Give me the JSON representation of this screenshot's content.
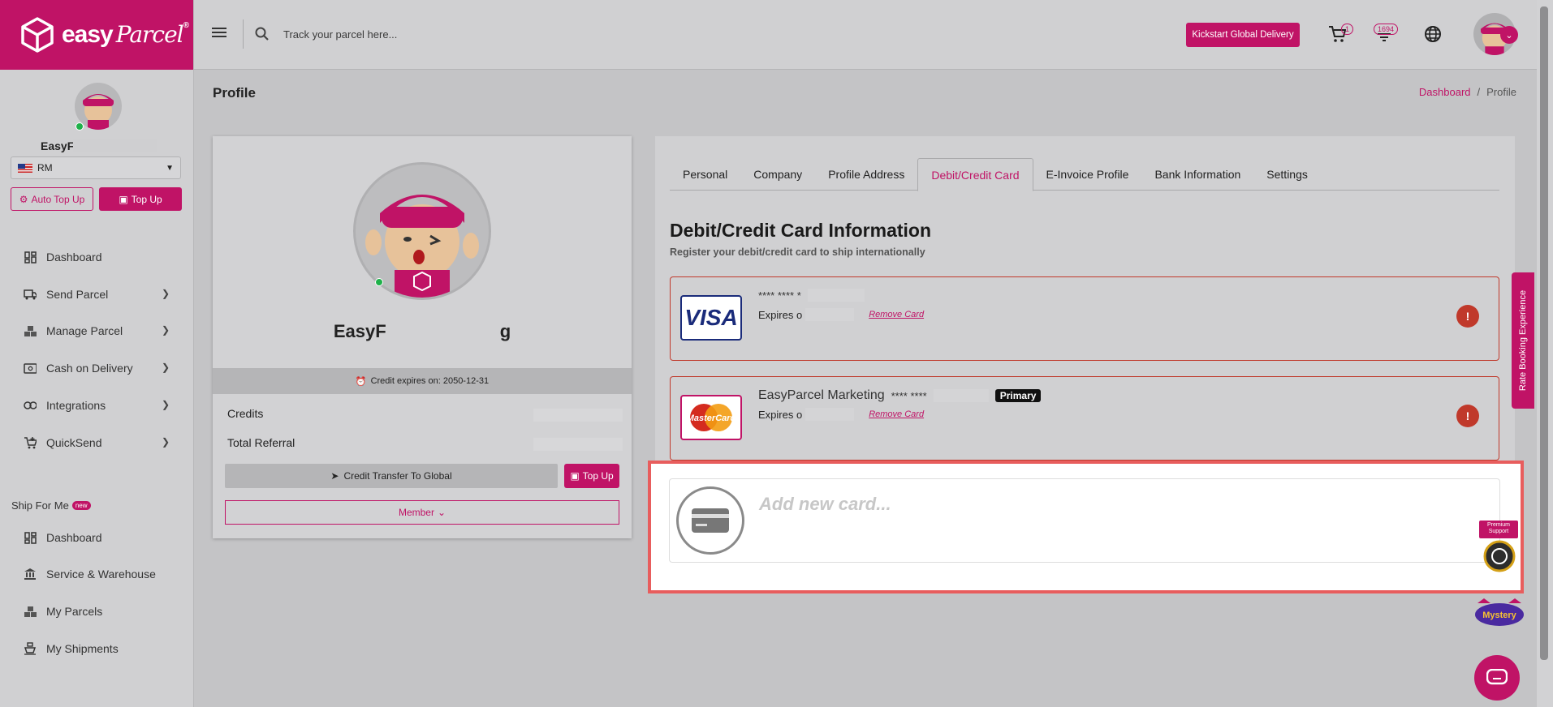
{
  "brand": {
    "name": "easy",
    "script": "Parcel",
    "reg": "®"
  },
  "sidebar": {
    "user_name": "EasyF",
    "wallet_currency": "RM",
    "auto_topup_label": "Auto Top Up",
    "topup_label": "Top Up",
    "nav": [
      {
        "label": "Dashboard",
        "icon": "dashboard-icon"
      },
      {
        "label": "Send Parcel",
        "icon": "truck-icon"
      },
      {
        "label": "Manage Parcel",
        "icon": "boxes-icon"
      },
      {
        "label": "Cash on Delivery",
        "icon": "cash-icon"
      },
      {
        "label": "Integrations",
        "icon": "link-icon"
      },
      {
        "label": "QuickSend",
        "icon": "cart-plus-icon"
      }
    ],
    "ship_for_me_label": "Ship For Me",
    "new_badge": "new",
    "ship_nav": [
      {
        "label": "Dashboard",
        "icon": "dashboard-icon"
      },
      {
        "label": "Service & Warehouse",
        "icon": "bank-icon"
      },
      {
        "label": "My Parcels",
        "icon": "boxes-icon"
      },
      {
        "label": "My Shipments",
        "icon": "ship-icon"
      }
    ]
  },
  "topbar": {
    "search_placeholder": "Track your parcel here...",
    "kickstart_label": "Kickstart Global Delivery",
    "cart_count": "1",
    "notification_count": "1694"
  },
  "page": {
    "title": "Profile",
    "breadcrumb": [
      "Dashboard",
      "/",
      "Profile"
    ]
  },
  "profile": {
    "name_start": "EasyF",
    "name_end": "g",
    "credit_expiry": "Credit expires on: 2050-12-31",
    "credits_label": "Credits",
    "referral_label": "Total Referral",
    "transfer_label": "Credit Transfer To Global",
    "topup_label": "Top Up",
    "member_label": "Member"
  },
  "tabs": [
    "Personal",
    "Company",
    "Profile Address",
    "Debit/Credit Card",
    "E-Invoice Profile",
    "Bank Information",
    "Settings"
  ],
  "active_tab": "Debit/Credit Card",
  "cards_section": {
    "title": "Debit/Credit Card Information",
    "subtitle": "Register your debit/credit card to ship internationally",
    "cards": [
      {
        "brand": "VISA",
        "holder": "",
        "number": "**** **** *",
        "expires": "Expires o",
        "remove": "Remove Card",
        "primary": ""
      },
      {
        "brand": "MasterCard",
        "holder": "EasyParcel Marketing",
        "number": "**** ****",
        "expires": "Expires o",
        "remove": "Remove Card",
        "primary": "Primary"
      }
    ],
    "add_card_label": "Add new card..."
  },
  "floating": {
    "rate_booking": "Rate Booking Experience",
    "premium_support": "Premium Support",
    "mystery": "Mystery"
  },
  "colors": {
    "brand": "#c01366",
    "warn": "#c0392b",
    "highlight": "#e85d5d"
  }
}
